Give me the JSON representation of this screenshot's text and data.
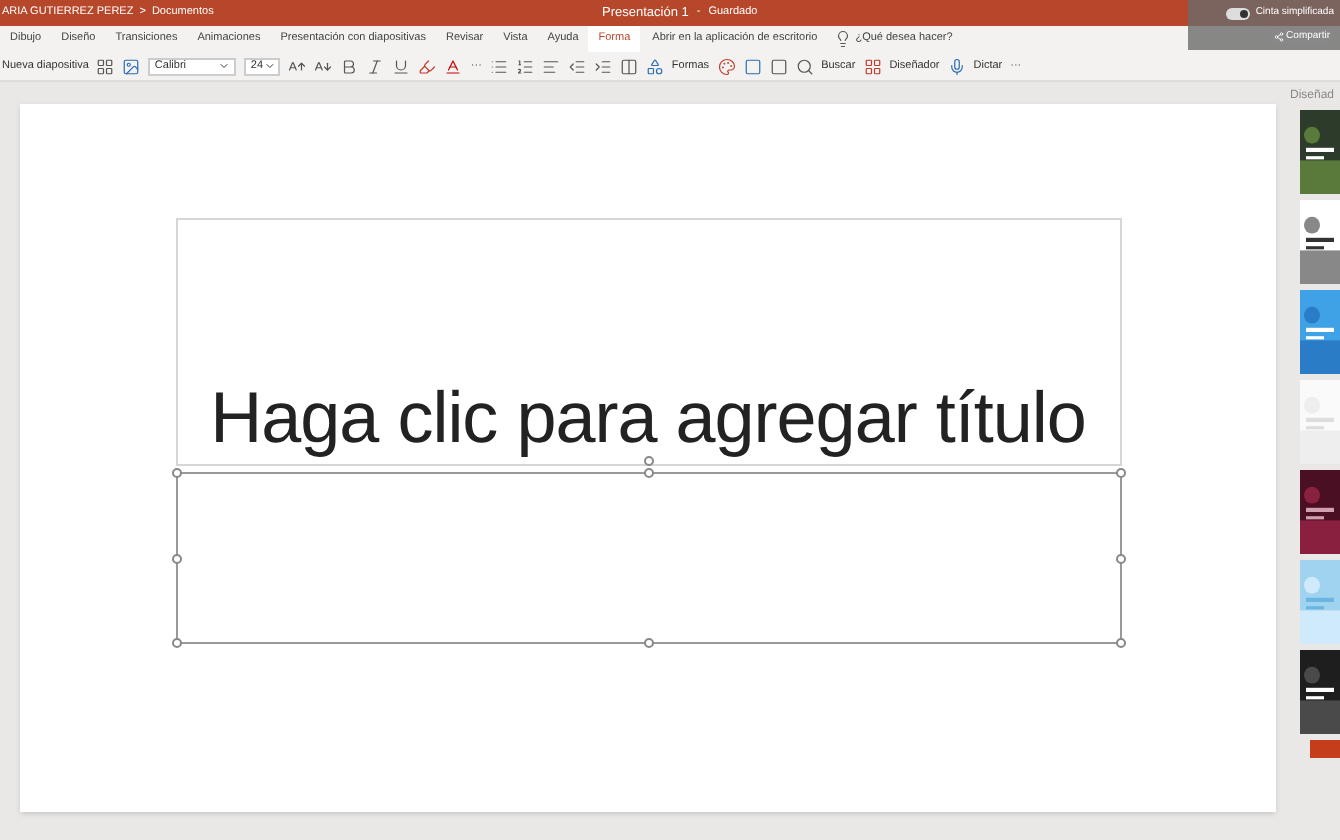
{
  "title_bar": {
    "user": "ARIA GUTIERREZ PEREZ",
    "breadcrumb_separator": ">",
    "folder": "Documentos",
    "document": "Presentación 1",
    "separator": "-",
    "save_status": "Guardado"
  },
  "overlay": {
    "toggle_label": "Cinta simplificada",
    "toggle_on": true,
    "share": "Compartir"
  },
  "tabs": [
    {
      "label": "Dibujo",
      "selected": false
    },
    {
      "label": "Diseño",
      "selected": false
    },
    {
      "label": "Transiciones",
      "selected": false
    },
    {
      "label": "Animaciones",
      "selected": false
    },
    {
      "label": "Presentación con diapositivas",
      "selected": false
    },
    {
      "label": "Revisar",
      "selected": false
    },
    {
      "label": "Vista",
      "selected": false
    },
    {
      "label": "Ayuda",
      "selected": false
    },
    {
      "label": "Forma",
      "selected": true
    }
  ],
  "open_desktop": "Abrir en la aplicación de escritorio",
  "tell_me": "¿Qué desea hacer?",
  "toolbar": {
    "new_slide": "Nueva diapositiva",
    "font": "Calibri",
    "size": "24",
    "more_left": "···",
    "shapes": "Formas",
    "search": "Buscar",
    "designer": "Diseñador",
    "dictate": "Dictar",
    "more_right": "···"
  },
  "slide": {
    "title_placeholder": "Haga clic para agregar título",
    "subtitle_selected": true
  },
  "design_pane": {
    "title": "Diseñad"
  }
}
